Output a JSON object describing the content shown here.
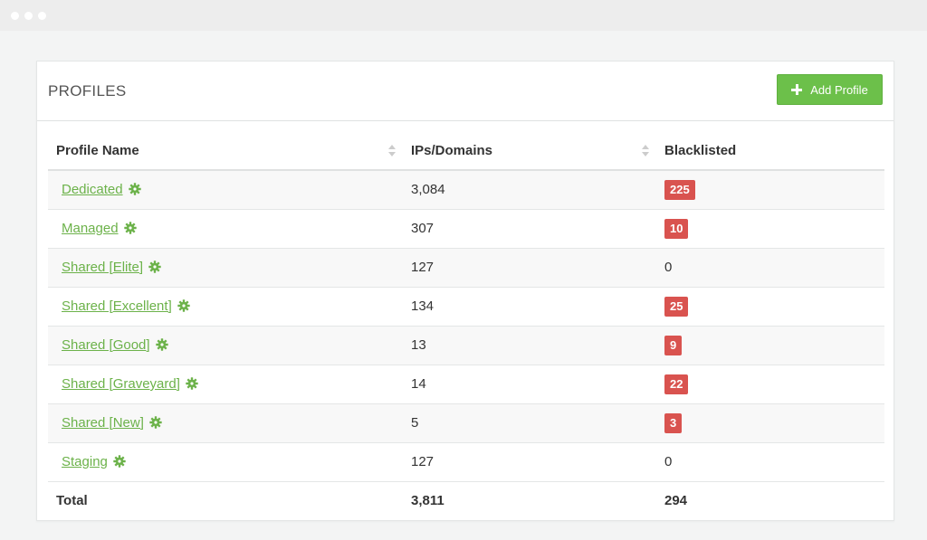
{
  "window": {
    "dots": 3
  },
  "panel": {
    "title": "PROFILES",
    "add_button_label": "Add Profile"
  },
  "table": {
    "headers": [
      "Profile Name",
      "IPs/Domains",
      "Blacklisted"
    ],
    "rows": [
      {
        "name": "Dedicated",
        "ips": "3,084",
        "blacklisted": "225",
        "flagged": true
      },
      {
        "name": "Managed",
        "ips": "307",
        "blacklisted": "10",
        "flagged": true
      },
      {
        "name": "Shared [Elite]",
        "ips": "127",
        "blacklisted": "0",
        "flagged": false
      },
      {
        "name": "Shared [Excellent]",
        "ips": "134",
        "blacklisted": "25",
        "flagged": true
      },
      {
        "name": "Shared [Good]",
        "ips": "13",
        "blacklisted": "9",
        "flagged": true
      },
      {
        "name": "Shared [Graveyard]",
        "ips": "14",
        "blacklisted": "22",
        "flagged": true
      },
      {
        "name": "Shared [New]",
        "ips": "5",
        "blacklisted": "3",
        "flagged": true
      },
      {
        "name": "Staging",
        "ips": "127",
        "blacklisted": "0",
        "flagged": false
      }
    ],
    "total": {
      "label": "Total",
      "ips": "3,811",
      "blacklisted": "294"
    }
  },
  "colors": {
    "accent_green": "#6cc04a",
    "link_green": "#6cb24a",
    "badge_red": "#d9534f"
  }
}
